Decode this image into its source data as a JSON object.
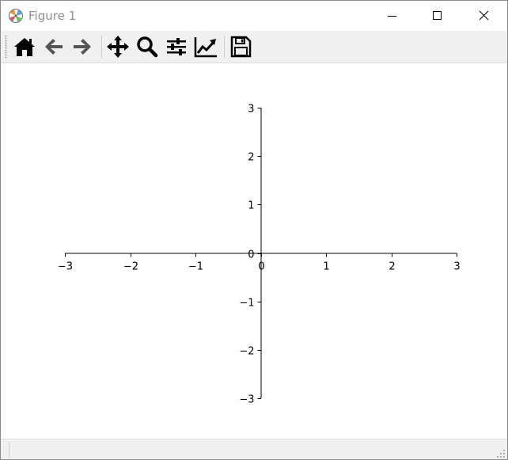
{
  "window": {
    "title": "Figure 1",
    "icon": "matplotlib-icon",
    "controls": {
      "minimize": "minimize-icon",
      "maximize": "maximize-icon",
      "close": "close-icon"
    }
  },
  "toolbar": {
    "tools": [
      {
        "name": "home",
        "icon": "home-icon"
      },
      {
        "name": "back",
        "icon": "arrow-left-icon"
      },
      {
        "name": "forward",
        "icon": "arrow-right-icon"
      },
      {
        "name": "pan",
        "icon": "move-icon"
      },
      {
        "name": "zoom",
        "icon": "magnifier-icon"
      },
      {
        "name": "subplots",
        "icon": "sliders-icon"
      },
      {
        "name": "edit-axes",
        "icon": "line-chart-icon"
      },
      {
        "name": "save",
        "icon": "floppy-icon"
      }
    ],
    "icon_color": "#000000",
    "disabled_color": "#555555"
  },
  "statusbar": {
    "text": ""
  },
  "chart_data": {
    "type": "line",
    "title": "",
    "xlabel": "",
    "ylabel": "",
    "xlim": [
      -3,
      3
    ],
    "ylim": [
      -3,
      3
    ],
    "x_ticks": [
      -3,
      -2,
      -1,
      0,
      1,
      2,
      3
    ],
    "y_ticks": [
      -3,
      -2,
      -1,
      0,
      1,
      2,
      3
    ],
    "x_tick_labels": [
      "−3",
      "−2",
      "−1",
      "0",
      "1",
      "2",
      "3"
    ],
    "y_tick_labels": [
      "−3",
      "−2",
      "−1",
      "0",
      "1",
      "2",
      "3"
    ],
    "spines": "centered",
    "grid": false,
    "series": []
  }
}
